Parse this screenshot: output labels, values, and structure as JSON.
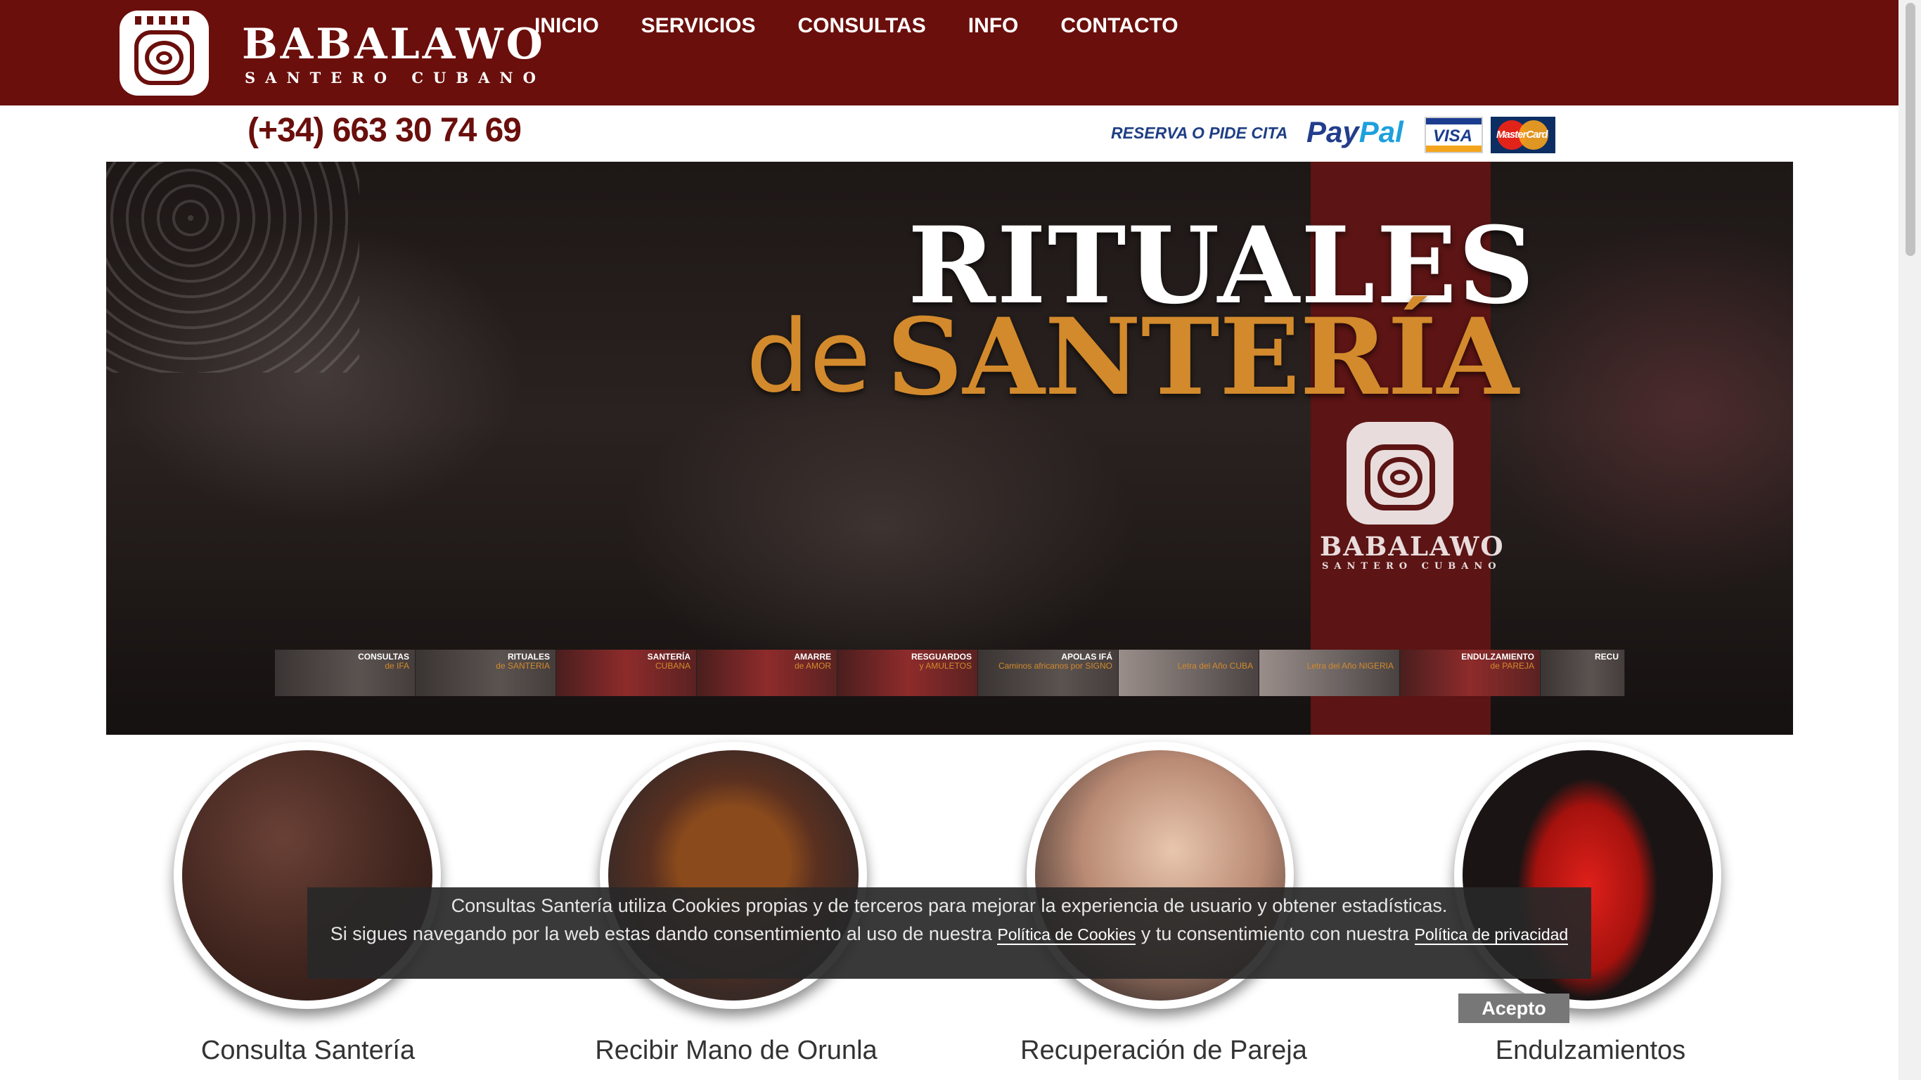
{
  "colors": {
    "brand": "#6a0f0c",
    "accent": "#d38a2c",
    "ribbon": "#5c1414"
  },
  "header": {
    "brand_name": "BABALAWO",
    "brand_sub": "SANTERO CUBANO",
    "logo_icon": "spiral-logo-icon",
    "nav": [
      {
        "label": "INICIO"
      },
      {
        "label": "SERVICIOS"
      },
      {
        "label": "CONSULTAS"
      },
      {
        "label": "INFO"
      },
      {
        "label": "CONTACTO"
      }
    ]
  },
  "subheader": {
    "phone": "(+34) 663 30 74 69",
    "reserve": "RESERVA O PIDE CITA",
    "paypal_pay": "Pay",
    "paypal_pal": "Pal",
    "visa": "VISA",
    "mastercard": "MasterCard"
  },
  "hero": {
    "title_line1": "RITUALES",
    "title_de": "de",
    "title_line2": "SANTERÍA",
    "logo_name": "BABALAWO",
    "logo_sub": "SANTERO CUBANO",
    "thumbnails": [
      {
        "title": "CONSULTAS",
        "sub": "de IFA",
        "style": "dark"
      },
      {
        "title": "RITUALES",
        "sub": "de SANTERIA",
        "style": "dark"
      },
      {
        "title": "SANTERÍA",
        "sub": "CUBANA",
        "style": "red"
      },
      {
        "title": "AMARRE",
        "sub": "de AMOR",
        "style": "red"
      },
      {
        "title": "RESGUARDOS",
        "sub": "y AMULETOS",
        "style": "red"
      },
      {
        "title": "APOLAS IFÁ",
        "sub": "Caminos africanos por SIGNO",
        "style": "dark"
      },
      {
        "title": "",
        "sub": "Letra del Año CUBA",
        "style": "lite"
      },
      {
        "title": "",
        "sub": "Letra del Año NIGERIA",
        "style": "lite"
      },
      {
        "title": "ENDULZAMIENTO",
        "sub": "de PAREJA",
        "style": "red"
      },
      {
        "title": "RECU",
        "sub": "",
        "style": "dark"
      }
    ]
  },
  "services": [
    {
      "label": "Consulta Santería"
    },
    {
      "label": "Recibir Mano de Orunla"
    },
    {
      "label": "Recuperación de Pareja"
    },
    {
      "label": "Endulzamientos"
    }
  ],
  "cookie": {
    "line1": "Consultas Santería utiliza Cookies propias y de terceros para mejorar la experiencia de usuario y obtener estadísticas.",
    "line2_pre": "Si sigues navegando por la web estas dando consentimiento al uso de nuestra",
    "cookies_link": "Política de Cookies",
    "line2_mid": "y tu consentimiento con nuestra",
    "privacy_link": "Política de privacidad",
    "accept": "Acepto"
  }
}
